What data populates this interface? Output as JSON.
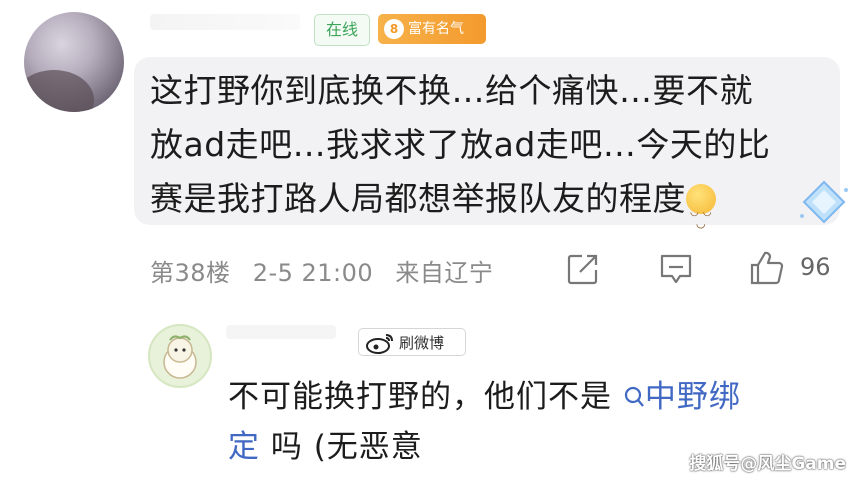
{
  "comment": {
    "badges": {
      "online": "在线",
      "rich_level": "8",
      "rich_label": "富有名气"
    },
    "lines": [
      "这打野你到底换不换…给个痛快…要不就",
      "放ad走吧…我求求了放ad走吧…今天的比",
      "赛是我打路人局都想举报队友的程度"
    ],
    "floor": "第38楼",
    "time": "2-5 21:00",
    "location": "来自辽宁",
    "likes": "96",
    "icons": [
      "share-icon",
      "comment-icon",
      "thumbs-up-icon",
      "smile-emoji",
      "diamond-decoration"
    ]
  },
  "reply": {
    "badge_label": "刷微博",
    "text_before": "不可能换打野的，他们不是",
    "link_text": "中野绑",
    "text_line2_link": "定",
    "text_after": " 吗 (无恶意"
  },
  "watermark": "搜狐号@风尘Game"
}
